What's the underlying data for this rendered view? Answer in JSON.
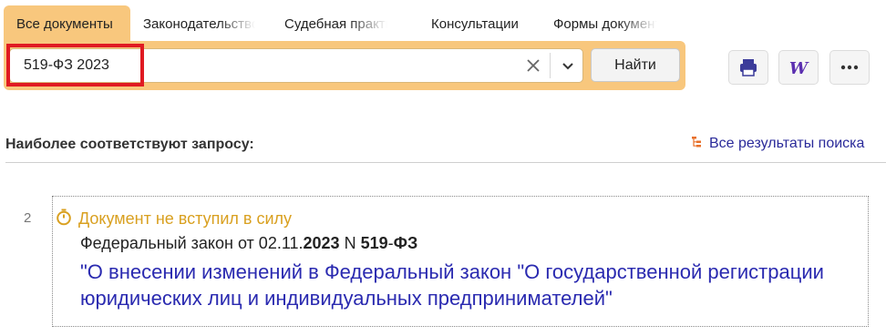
{
  "tabs": [
    {
      "label": "Все документы",
      "active": true
    },
    {
      "label": "Законодательство",
      "active": false
    },
    {
      "label": "Судебная практика",
      "active": false
    },
    {
      "label": "Консультации",
      "active": false
    },
    {
      "label": "Формы документов",
      "active": false
    }
  ],
  "search": {
    "query": "519-ФЗ 2023",
    "find_label": "Найти"
  },
  "toolbar": {
    "print_icon": "printer-icon",
    "word_icon": "word-icon",
    "more_icon": "more-icon"
  },
  "results": {
    "heading": "Наиболее соответствуют запросу:",
    "all_results_label": "Все результаты поиска",
    "items": [
      {
        "number": "2",
        "status": "Документ не вступил в силу",
        "meta_prefix": "Федеральный закон от 02.11.",
        "meta_year": "2023",
        "meta_mid": " N ",
        "meta_num": "519",
        "meta_dash": "-",
        "meta_fz": "ФЗ",
        "title": "\"О внесении изменений в Федеральный закон \"О государственной регистрации юридических лиц и индивидуальных предпринимателей\""
      }
    ]
  },
  "colors": {
    "accent": "#f8c77d",
    "highlight": "#e01a22",
    "link": "#2a2ab0",
    "status": "#d9a020"
  }
}
